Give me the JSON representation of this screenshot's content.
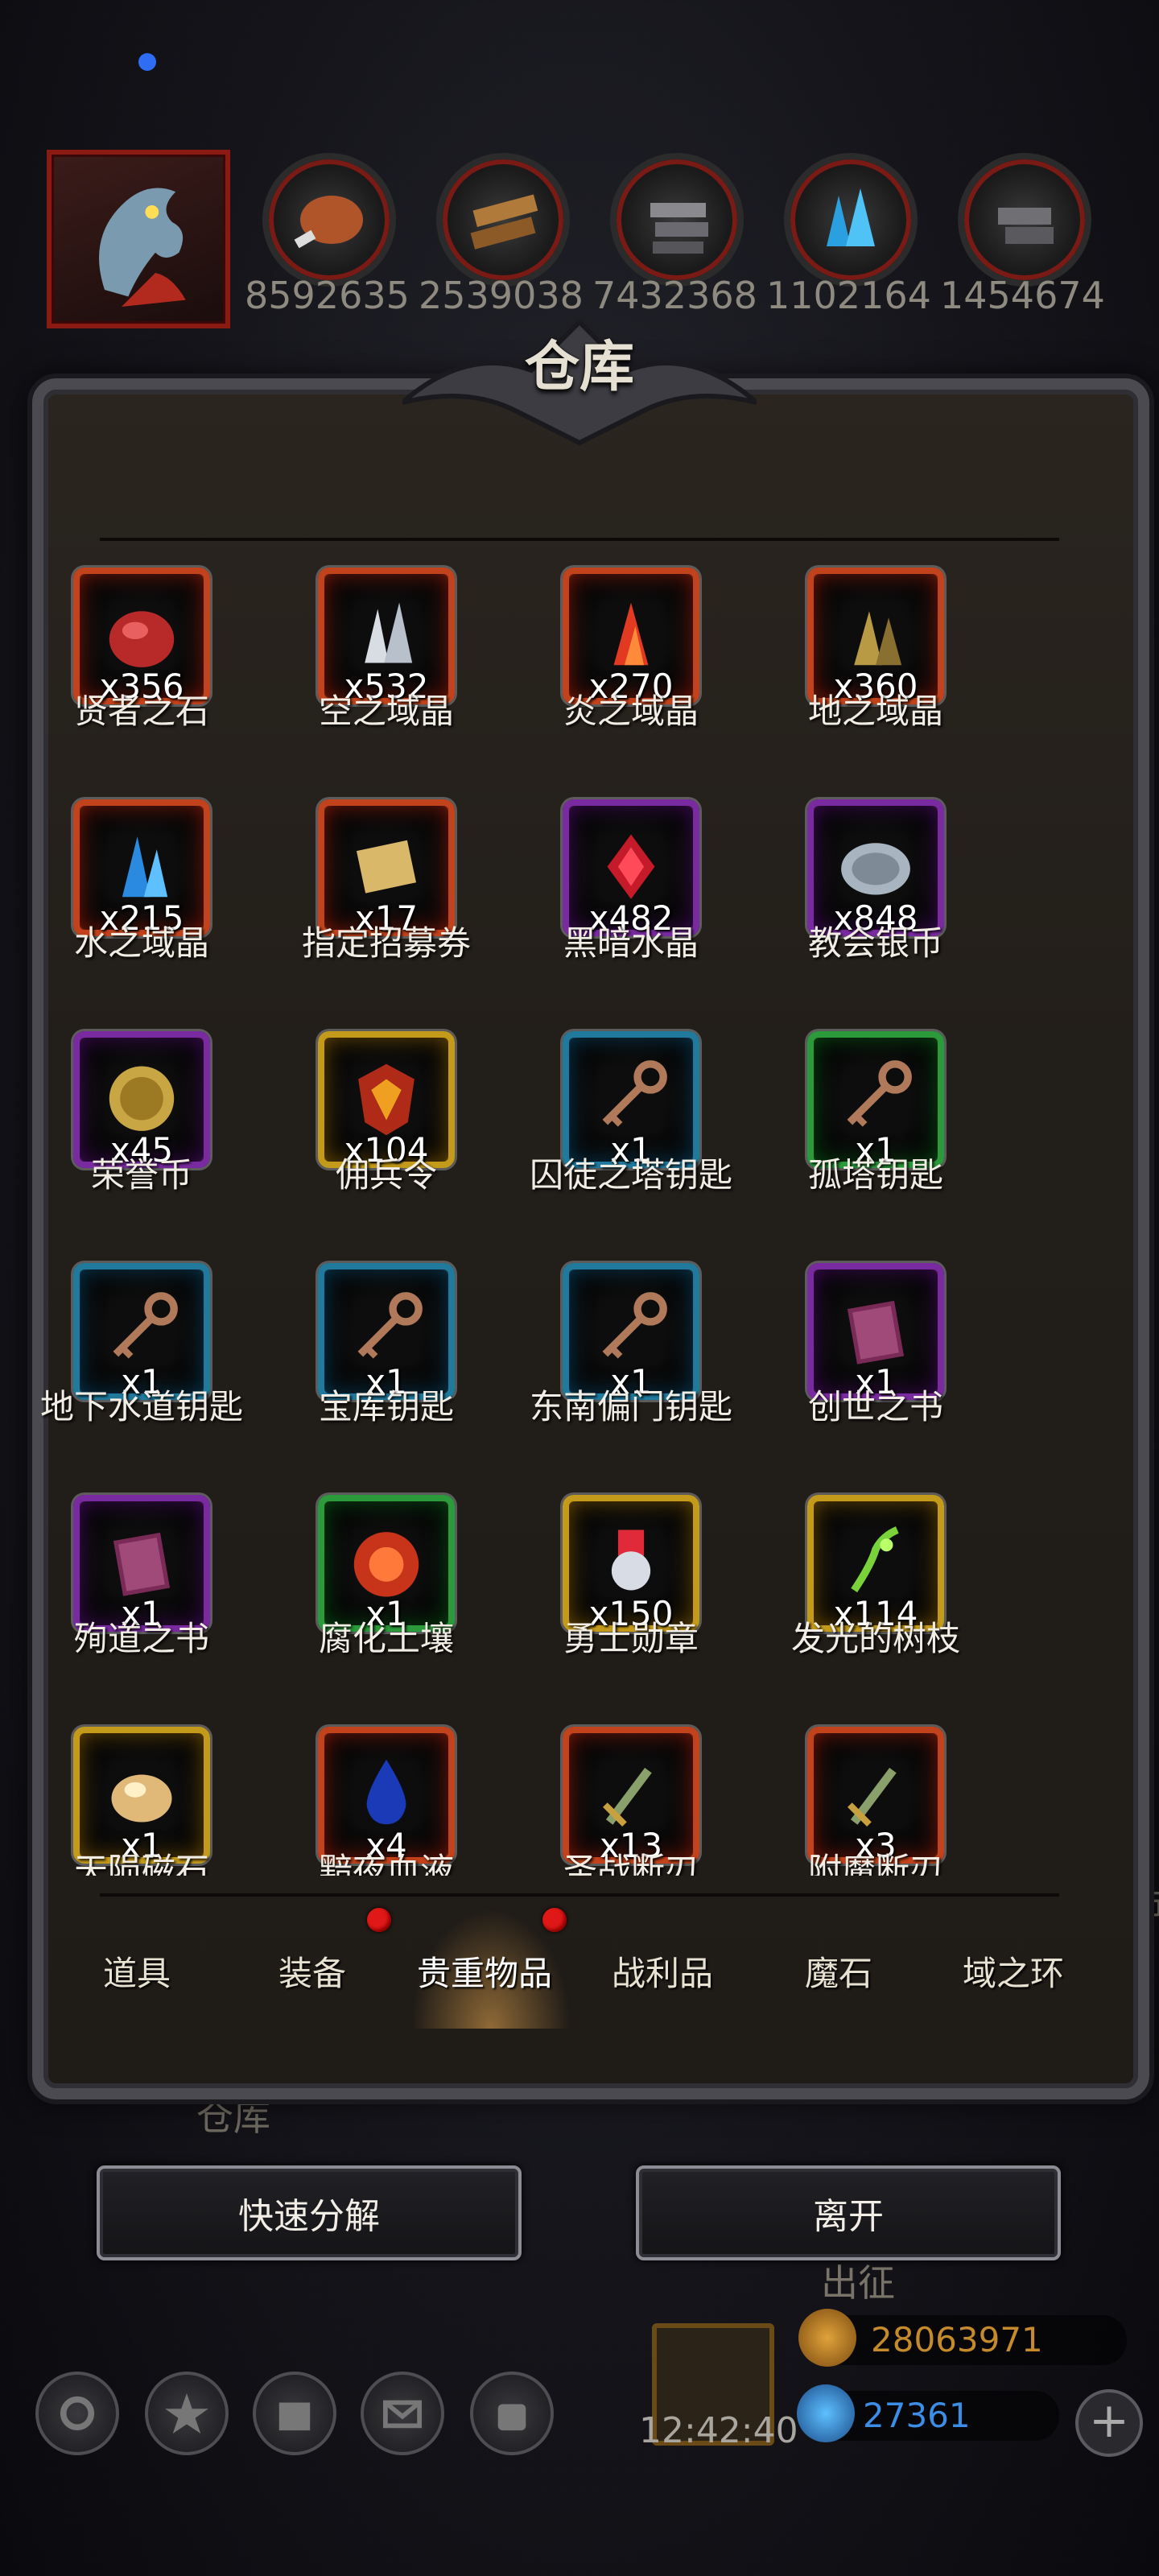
{
  "resources": [
    {
      "icon": "meat-icon",
      "value": "8592635"
    },
    {
      "icon": "wood-icon",
      "value": "2539038"
    },
    {
      "icon": "iron-icon",
      "value": "7432368"
    },
    {
      "icon": "crystal-icon",
      "value": "1102164"
    },
    {
      "icon": "stone-icon",
      "value": "1454674"
    }
  ],
  "panel": {
    "title": "仓库"
  },
  "items": [
    {
      "name": "贤者之石",
      "count": "x356",
      "quality": "red",
      "icon": "red-stone-icon"
    },
    {
      "name": "空之域晶",
      "count": "x532",
      "quality": "red",
      "icon": "white-crystal-icon"
    },
    {
      "name": "炎之域晶",
      "count": "x270",
      "quality": "red",
      "icon": "fire-crystal-icon"
    },
    {
      "name": "地之域晶",
      "count": "x360",
      "quality": "red",
      "icon": "earth-crystal-icon"
    },
    {
      "name": "水之域晶",
      "count": "x215",
      "quality": "red",
      "icon": "water-crystal-icon"
    },
    {
      "name": "指定招募券",
      "count": "x17",
      "quality": "red",
      "icon": "scroll-icon"
    },
    {
      "name": "黑暗水晶",
      "count": "x482",
      "quality": "purple",
      "icon": "dark-crystal-icon"
    },
    {
      "name": "教会银币",
      "count": "x848",
      "quality": "purple",
      "icon": "silver-coin-icon"
    },
    {
      "name": "荣誉币",
      "count": "x45",
      "quality": "purple",
      "icon": "gold-coin-icon"
    },
    {
      "name": "佣兵令",
      "count": "x104",
      "quality": "gold",
      "icon": "emblem-icon"
    },
    {
      "name": "囚徒之塔钥匙",
      "count": "x1",
      "quality": "blue",
      "icon": "key-icon"
    },
    {
      "name": "孤塔钥匙",
      "count": "x1",
      "quality": "green",
      "icon": "key-icon"
    },
    {
      "name": "地下水道钥匙",
      "count": "x1",
      "quality": "blue",
      "icon": "key-icon"
    },
    {
      "name": "宝库钥匙",
      "count": "x1",
      "quality": "blue",
      "icon": "key-icon"
    },
    {
      "name": "东南偏门钥匙",
      "count": "x1",
      "quality": "blue",
      "icon": "key-icon"
    },
    {
      "name": "创世之书",
      "count": "x1",
      "quality": "purple",
      "icon": "book-icon"
    },
    {
      "name": "殉道之书",
      "count": "x1",
      "quality": "purple",
      "icon": "book-icon"
    },
    {
      "name": "腐化土壤",
      "count": "x1",
      "quality": "green",
      "icon": "soil-icon"
    },
    {
      "name": "勇士勋章",
      "count": "x150",
      "quality": "gold",
      "icon": "medal-icon"
    },
    {
      "name": "发光的树枝",
      "count": "x114",
      "quality": "gold",
      "icon": "branch-icon"
    },
    {
      "name": "天陨磁石",
      "count": "x1",
      "quality": "gold",
      "icon": "magnet-stone-icon"
    },
    {
      "name": "黯夜血液",
      "count": "x4",
      "quality": "red",
      "icon": "blood-drop-icon"
    },
    {
      "name": "圣战断刃",
      "count": "x13",
      "quality": "red",
      "icon": "broken-blade-icon"
    },
    {
      "name": "附魔断刃",
      "count": "x3",
      "quality": "red",
      "icon": "broken-blade-icon"
    }
  ],
  "tabs": [
    {
      "label": "道具",
      "badge": false
    },
    {
      "label": "装备",
      "badge": true
    },
    {
      "label": "贵重物品",
      "badge": true,
      "active": true
    },
    {
      "label": "战利品",
      "badge": false
    },
    {
      "label": "魔石",
      "badge": false
    },
    {
      "label": "域之环",
      "badge": false
    }
  ],
  "buttons": {
    "decompose": "快速分解",
    "leave": "离开"
  },
  "background": {
    "under_panel_label": "仓库",
    "expedition_label": "出征",
    "right_edge_char": "市",
    "time": "12:42:40",
    "gold_value": "28063971",
    "gem_value": "27361"
  },
  "colors": {
    "red": "#c2421b",
    "purple": "#7a2aa0",
    "gold": "#c49a1a",
    "blue": "#1f7a9e",
    "green": "#2a9a3a",
    "badge": "#e11818"
  }
}
